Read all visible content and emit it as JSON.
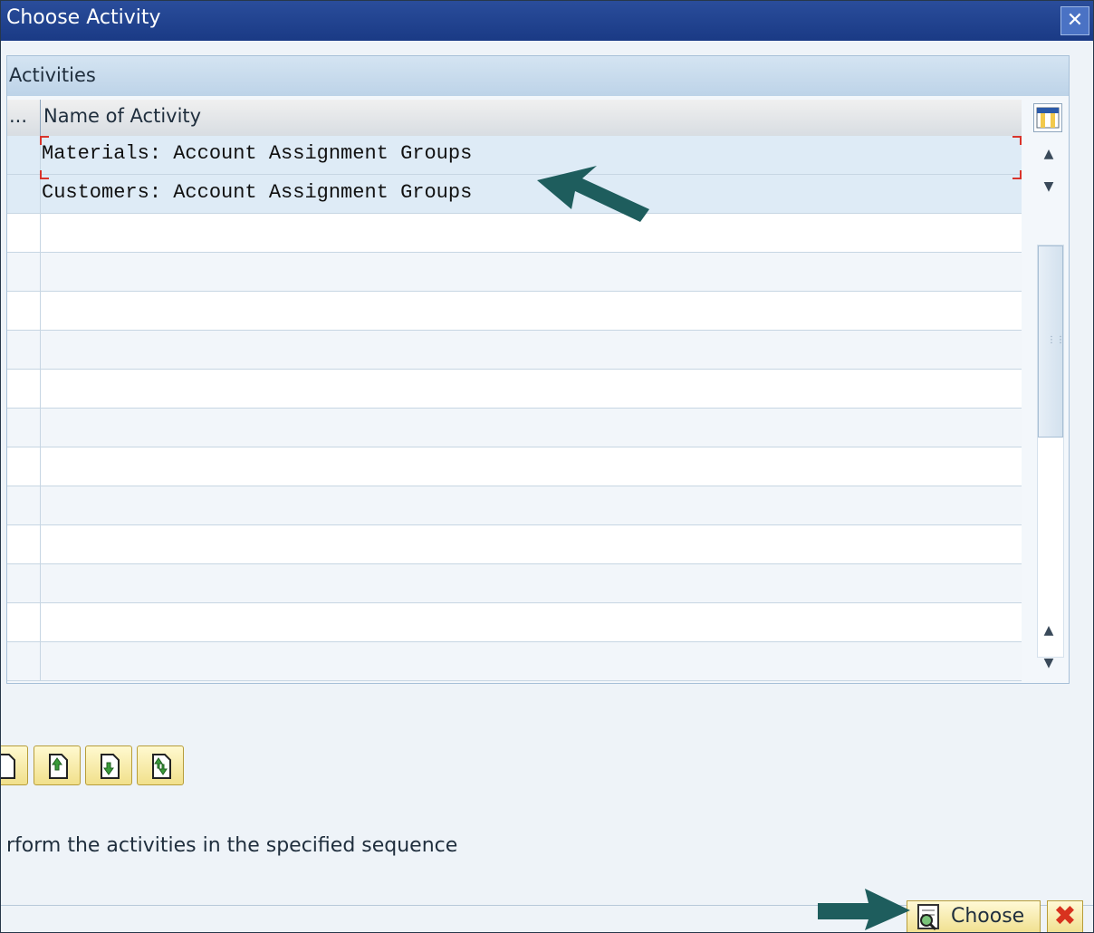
{
  "window": {
    "title": "Choose Activity",
    "close_glyph": "✕"
  },
  "panel": {
    "title": "Activities",
    "columns": [
      {
        "label": "..."
      },
      {
        "label": "Name of Activity"
      }
    ]
  },
  "activities": [
    {
      "name": "Materials: Account Assignment Groups"
    },
    {
      "name": "Customers: Account Assignment Groups"
    }
  ],
  "toolbar": {
    "icons": [
      "doc-icon",
      "doc-up-icon",
      "doc-down-icon",
      "doc-swap-icon"
    ]
  },
  "info_text": "rform the activities in the specified sequence",
  "footer": {
    "choose_label": "Choose",
    "cancel_glyph": "✖"
  },
  "colors": {
    "title_bar": "#1a3a85",
    "selection": "#deebf6",
    "annotation_arrow": "#1e5d5d",
    "cancel_red": "#d8321e"
  }
}
